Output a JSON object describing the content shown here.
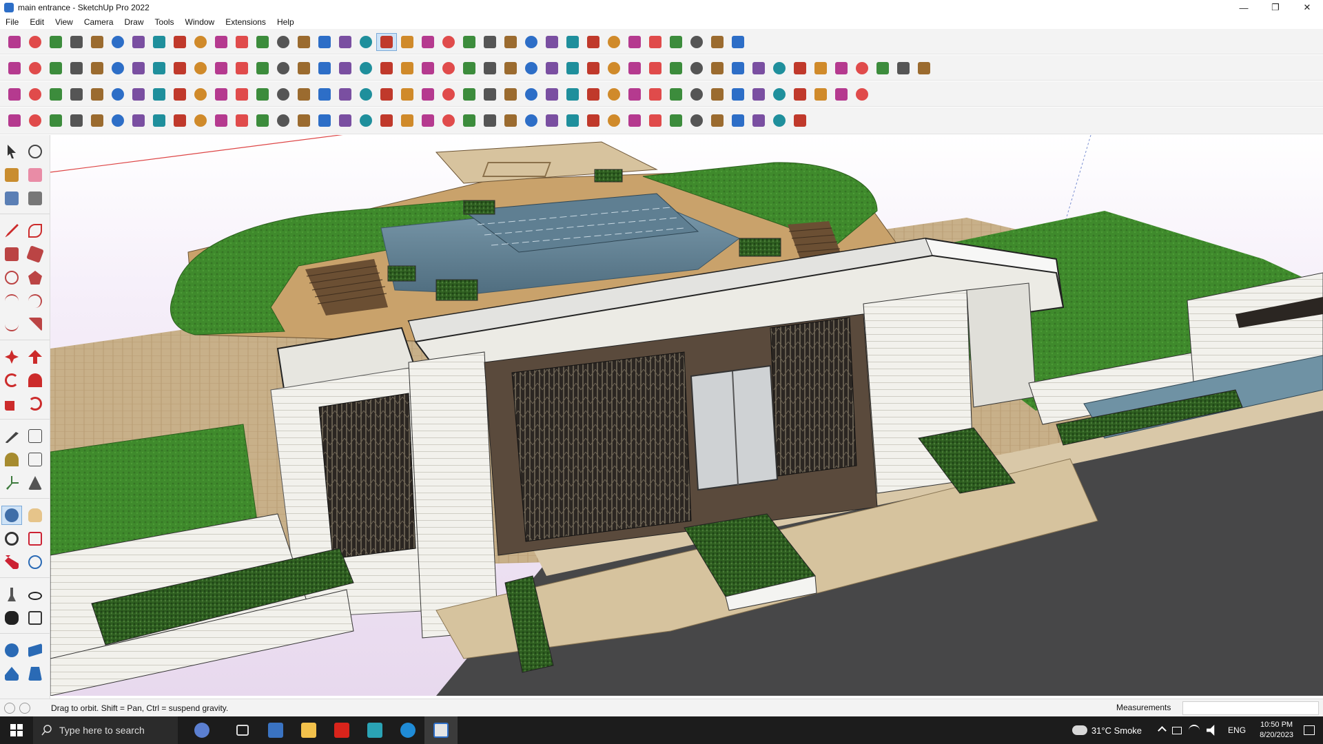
{
  "window": {
    "title": "main entrance - SketchUp Pro 2022",
    "controls": [
      "minimize",
      "restore",
      "close"
    ]
  },
  "menu": [
    "File",
    "Edit",
    "View",
    "Camera",
    "Draw",
    "Tools",
    "Window",
    "Extensions",
    "Help"
  ],
  "toolbars": {
    "row1": [
      "zoom-extents-icon",
      "select-icon",
      "select-dropdown-icon",
      "eraser-icon",
      "pencil-icon",
      "line-dropdown-icon",
      "lasso-icon",
      "lasso-dropdown-icon",
      "rectangle-icon",
      "rectangle-dropdown-icon",
      "push-pull-icon",
      "follow-me-icon",
      "move-icon",
      "rotate-icon",
      "scale-icon",
      "tape-measure-icon",
      "text-icon",
      "paint-bucket-icon",
      "orbit-icon",
      "pan-icon",
      "zoom-icon",
      "zoom-window-icon",
      "walk-icon",
      "section-icon",
      "display-section-icon",
      "layers-icon",
      "components-icon",
      "dropdown-icon",
      "mirror-icon",
      "axis-icon",
      "flip-icon",
      "align-icon",
      "arrange-icon",
      "undo-icon",
      "redo-icon",
      "plugin-icon"
    ],
    "row2_count": 45,
    "row3_count": 42,
    "row4_count": 39
  },
  "status": {
    "text": "Drag to orbit. Shift = Pan, Ctrl = suspend gravity.",
    "measurements_label": "Measurements",
    "measurements_value": ""
  },
  "taskbar": {
    "search_placeholder": "Type here to search",
    "weather": "31°C  Smoke",
    "language": "ENG",
    "time": "10:50 PM",
    "date": "8/20/2023"
  },
  "colors": {
    "grass": "#3f8a2c",
    "sky": "#e8d9ee",
    "wall": "#ecebe5",
    "water": "#6e8ea0",
    "paving": "#c8b089"
  }
}
